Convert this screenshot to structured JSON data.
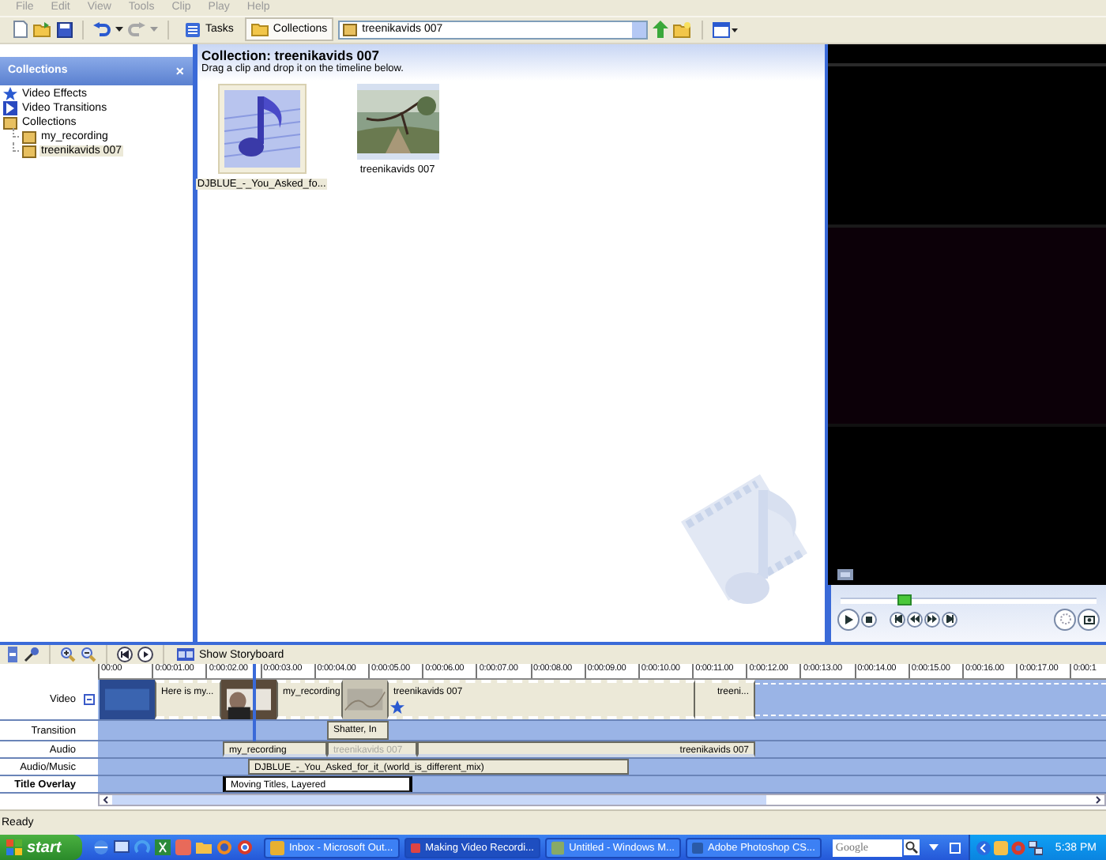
{
  "menu": [
    "File",
    "Edit",
    "View",
    "Tools",
    "Clip",
    "Play",
    "Help"
  ],
  "toolbar": {
    "buttons": [
      {
        "label": "Tasks",
        "selected": false
      },
      {
        "label": "Collections",
        "selected": true
      }
    ],
    "collection": "treenikavids 007"
  },
  "sidebar": {
    "title": "Collections",
    "close": "×",
    "items": [
      {
        "label": "Video Effects",
        "kind": "effects",
        "selected": false
      },
      {
        "label": "Video Transitions",
        "kind": "transitions",
        "selected": false
      },
      {
        "label": "Collections",
        "kind": "collection",
        "selected": false,
        "children": [
          {
            "label": "my_recording",
            "kind": "collection",
            "selected": false
          },
          {
            "label": "treenikavids 007",
            "kind": "collection",
            "selected": true
          }
        ]
      }
    ]
  },
  "content": {
    "title": "Collection: treenikavids 007",
    "hint": "Drag a clip and drop it on the timeline below.",
    "clips": [
      {
        "kind": "audio",
        "label": "DJBLUE_-_You_Asked_fo...",
        "selected": true
      },
      {
        "kind": "video",
        "label": "treenikavids 007",
        "selected": false
      }
    ]
  },
  "preview": {
    "level": 0.22
  },
  "timeline": {
    "storyboard_button": "Show Storyboard",
    "ruler": [
      "00:00",
      "0:00:01.00",
      "0:00:02.00",
      "0:00:03.00",
      "0:00:04.00",
      "0:00:05.00",
      "0:00:06.00",
      "0:00:07.00",
      "0:00:08.00",
      "0:00:09.00",
      "0:00:10.00",
      "0:00:11.00",
      "0:00:12.00",
      "0:00:13.00",
      "0:00:14.00",
      "0:00:15.00",
      "0:00:16.00",
      "0:00:17.00",
      "0:00:1"
    ],
    "tracks": [
      {
        "label": "Video",
        "bold": false,
        "expanded": true,
        "clips": [
          {
            "kind": "picture"
          },
          {
            "kind": "clip",
            "label": "Here is my..."
          },
          {
            "kind": "picture"
          },
          {
            "kind": "clip",
            "label": "my_recording"
          },
          {
            "kind": "picture"
          },
          {
            "kind": "clip",
            "label": "treenikavids 007",
            "effect": true
          },
          {
            "kind": "clip",
            "label": "treeni..."
          }
        ]
      },
      {
        "label": "Transition",
        "bold": false,
        "clips": [
          {
            "kind": "transition",
            "label": "Shatter, In"
          }
        ]
      },
      {
        "label": "Audio",
        "bold": false,
        "clips": [
          {
            "kind": "audio",
            "label": "my_recording",
            "dimmed": false
          },
          {
            "kind": "audio",
            "label": "treenikavids 007",
            "dimmed": true
          },
          {
            "kind": "audio",
            "label": "treenikavids 007",
            "dimmed": false
          }
        ]
      },
      {
        "label": "Audio/Music",
        "bold": false,
        "clips": [
          {
            "kind": "music",
            "label": "DJBLUE_-_You_Asked_for_it_(world_is_different_mix)"
          }
        ]
      },
      {
        "label": "Title Overlay",
        "bold": true,
        "clips": [
          {
            "kind": "title",
            "label": "Moving Titles, Layered"
          }
        ]
      }
    ]
  },
  "status": "Ready",
  "taskbar": {
    "start": "start",
    "tasks": [
      {
        "label": "Inbox - Microsoft Out...",
        "kind": "mail",
        "selected": false
      },
      {
        "label": "Making Video Recordi...",
        "kind": "browser",
        "selected": true
      },
      {
        "label": "Untitled - Windows M...",
        "kind": "movie",
        "selected": false
      },
      {
        "label": "Adobe Photoshop CS...",
        "selected": false
      }
    ],
    "search_placeholder": "Google",
    "clock": "5:38 PM"
  }
}
